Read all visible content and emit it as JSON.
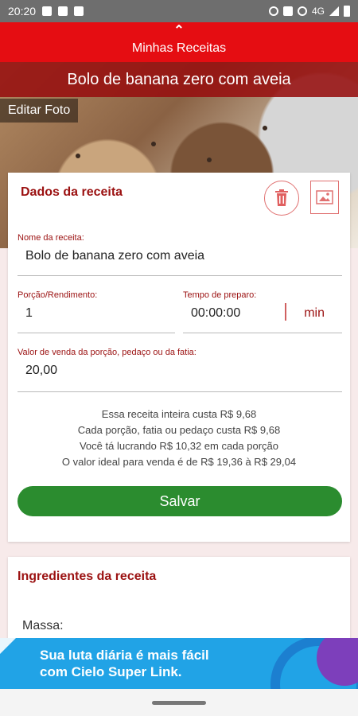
{
  "status_bar": {
    "time": "20:20",
    "network": "4G"
  },
  "header": {
    "title": "Minhas Receitas",
    "chevron_icon": "chevron-up-icon"
  },
  "recipe": {
    "name": "Bolo de banana zero com aveia",
    "edit_photo_label": "Editar Foto"
  },
  "form": {
    "section_title": "Dados da receita",
    "actions": {
      "delete_icon": "trash-icon",
      "photo_icon": "image-icon"
    },
    "name": {
      "label": "Nome da receita:",
      "value": "Bolo de banana zero com aveia"
    },
    "portion": {
      "label": "Porção/Rendimento:",
      "value": "1"
    },
    "prep_time": {
      "label": "Tempo de preparo:",
      "value": "00:00:00",
      "unit": "min"
    },
    "sale_price": {
      "label": "Valor de venda da porção, pedaço ou da fatia:",
      "value": "20,00"
    },
    "summary": [
      "Essa receita inteira custa R$ 9,68",
      "Cada porção, fatia ou pedaço custa R$ 9,68",
      "Você tá lucrando R$ 10,32 em cada porção",
      "O valor ideal para venda é de R$ 19,36 à R$ 29,04"
    ],
    "save_label": "Salvar"
  },
  "ingredients": {
    "section_title": "Ingredientes da receita",
    "group_label": "Massa:"
  },
  "ad": {
    "line1": "Sua luta diária é mais fácil",
    "line2": "com Cielo Super Link."
  },
  "colors": {
    "primary": "#e50d12",
    "dark_red": "#9b1111",
    "save_green": "#2b8c2f",
    "ad_blue": "#21a3e6"
  }
}
